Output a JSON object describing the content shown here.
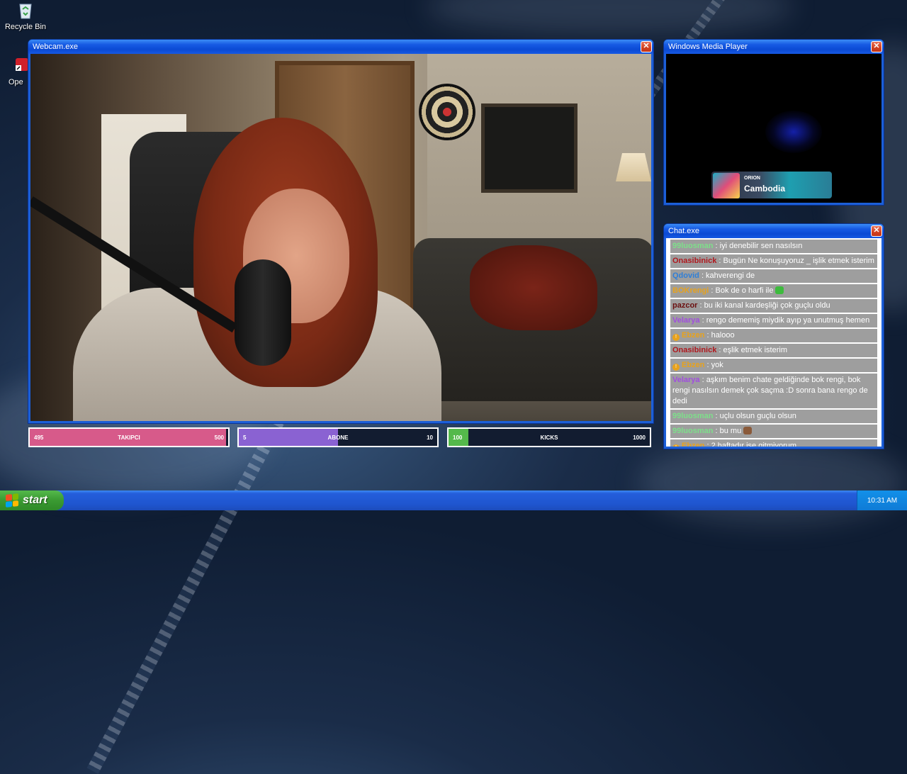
{
  "desktop": {
    "icons": [
      {
        "label": "Recycle Bin"
      },
      {
        "label": "Ope"
      }
    ]
  },
  "webcam_window": {
    "title": "Webcam.exe"
  },
  "wmp_window": {
    "title": "Windows Media Player",
    "now_playing": {
      "artist": "ORION",
      "title": "Cambodia"
    }
  },
  "chat_window": {
    "title": "Chat.exe",
    "messages": [
      {
        "user": "99luosman",
        "color": "#7de08a",
        "text": " : iyi denebilir sen nasılsın",
        "badge": false
      },
      {
        "user": "Onasibinick",
        "color": "#b0181e",
        "text": " : Bugün Ne konuşuyoruz _ işlik etmek isterim",
        "badge": false
      },
      {
        "user": "Qdovid",
        "color": "#2f7fd8",
        "text": " : kahverengi de",
        "badge": false
      },
      {
        "user": "BOKrengi",
        "color": "#e8a21b",
        "text": " : Bok de o harfi ile",
        "badge": false,
        "emote": "#3dbb3d"
      },
      {
        "user": "pazcor",
        "color": "#6b0f0f",
        "text": " : bu iki kanal kardeşliği çok guçlu oldu",
        "badge": false
      },
      {
        "user": "Velarya",
        "color": "#a14de0",
        "text": " : rengo dememiş miydik ayıp ya unutmuş hemen",
        "badge": false
      },
      {
        "user": "Ebzen",
        "color": "#e8a21b",
        "text": " : halooo",
        "badge": true
      },
      {
        "user": "Onasibinick",
        "color": "#b0181e",
        "text": " : eşlik etmek isterim",
        "badge": false
      },
      {
        "user": "Ebzen",
        "color": "#e8a21b",
        "text": " : yok",
        "badge": true
      },
      {
        "user": "Velarya",
        "color": "#a14de0",
        "text": " : aşkım benim chate geldiğinde bok rengi, bok rengi nasılsın demek çok saçma :D sonra bana rengo de dedi",
        "badge": false
      },
      {
        "user": "99luosman",
        "color": "#7de08a",
        "text": " : uçlu olsun guçlu olsun",
        "badge": false
      },
      {
        "user": "99luosman",
        "color": "#7de08a",
        "text": " : bu mu",
        "badge": false,
        "emote": "#8a5a3a"
      },
      {
        "user": "Ebzen",
        "color": "#e8a21b",
        "text": " : 2 haftadır işe gitmiyorum",
        "badge": true
      }
    ]
  },
  "goals": [
    {
      "label": "TAKIPCI",
      "current": "495",
      "target": "500",
      "fraction": 0.99,
      "color": "#d75a8a"
    },
    {
      "label": "ABONE",
      "current": "5",
      "target": "10",
      "fraction": 0.5,
      "color": "#8a62d2"
    },
    {
      "label": "KICKS",
      "current": "100",
      "target": "1000",
      "fraction": 0.1,
      "color": "#54b94b"
    }
  ],
  "taskbar": {
    "start_label": "start",
    "clock": "10:31 AM"
  }
}
